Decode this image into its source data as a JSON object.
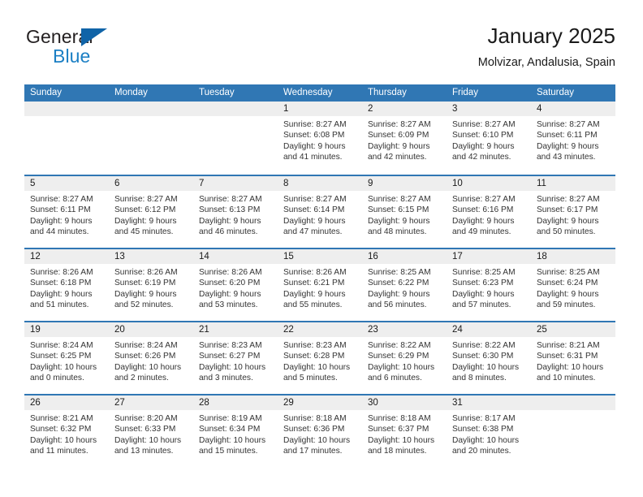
{
  "brand": {
    "name_part1": "General",
    "name_part2": "Blue",
    "flag_icon": "triangle-flag-icon",
    "accent_color": "#1064a8",
    "blue_text_color": "#1b7fc4"
  },
  "header": {
    "title": "January 2025",
    "subtitle": "Molvizar, Andalusia, Spain"
  },
  "theme": {
    "header_blue": "#3077b4",
    "day_band_gray": "#eeeeee",
    "text_color": "#333333"
  },
  "weekdays": [
    "Sunday",
    "Monday",
    "Tuesday",
    "Wednesday",
    "Thursday",
    "Friday",
    "Saturday"
  ],
  "weeks": [
    [
      {
        "day": "",
        "lines": []
      },
      {
        "day": "",
        "lines": []
      },
      {
        "day": "",
        "lines": []
      },
      {
        "day": "1",
        "lines": [
          "Sunrise: 8:27 AM",
          "Sunset: 6:08 PM",
          "Daylight: 9 hours",
          "and 41 minutes."
        ]
      },
      {
        "day": "2",
        "lines": [
          "Sunrise: 8:27 AM",
          "Sunset: 6:09 PM",
          "Daylight: 9 hours",
          "and 42 minutes."
        ]
      },
      {
        "day": "3",
        "lines": [
          "Sunrise: 8:27 AM",
          "Sunset: 6:10 PM",
          "Daylight: 9 hours",
          "and 42 minutes."
        ]
      },
      {
        "day": "4",
        "lines": [
          "Sunrise: 8:27 AM",
          "Sunset: 6:11 PM",
          "Daylight: 9 hours",
          "and 43 minutes."
        ]
      }
    ],
    [
      {
        "day": "5",
        "lines": [
          "Sunrise: 8:27 AM",
          "Sunset: 6:11 PM",
          "Daylight: 9 hours",
          "and 44 minutes."
        ]
      },
      {
        "day": "6",
        "lines": [
          "Sunrise: 8:27 AM",
          "Sunset: 6:12 PM",
          "Daylight: 9 hours",
          "and 45 minutes."
        ]
      },
      {
        "day": "7",
        "lines": [
          "Sunrise: 8:27 AM",
          "Sunset: 6:13 PM",
          "Daylight: 9 hours",
          "and 46 minutes."
        ]
      },
      {
        "day": "8",
        "lines": [
          "Sunrise: 8:27 AM",
          "Sunset: 6:14 PM",
          "Daylight: 9 hours",
          "and 47 minutes."
        ]
      },
      {
        "day": "9",
        "lines": [
          "Sunrise: 8:27 AM",
          "Sunset: 6:15 PM",
          "Daylight: 9 hours",
          "and 48 minutes."
        ]
      },
      {
        "day": "10",
        "lines": [
          "Sunrise: 8:27 AM",
          "Sunset: 6:16 PM",
          "Daylight: 9 hours",
          "and 49 minutes."
        ]
      },
      {
        "day": "11",
        "lines": [
          "Sunrise: 8:27 AM",
          "Sunset: 6:17 PM",
          "Daylight: 9 hours",
          "and 50 minutes."
        ]
      }
    ],
    [
      {
        "day": "12",
        "lines": [
          "Sunrise: 8:26 AM",
          "Sunset: 6:18 PM",
          "Daylight: 9 hours",
          "and 51 minutes."
        ]
      },
      {
        "day": "13",
        "lines": [
          "Sunrise: 8:26 AM",
          "Sunset: 6:19 PM",
          "Daylight: 9 hours",
          "and 52 minutes."
        ]
      },
      {
        "day": "14",
        "lines": [
          "Sunrise: 8:26 AM",
          "Sunset: 6:20 PM",
          "Daylight: 9 hours",
          "and 53 minutes."
        ]
      },
      {
        "day": "15",
        "lines": [
          "Sunrise: 8:26 AM",
          "Sunset: 6:21 PM",
          "Daylight: 9 hours",
          "and 55 minutes."
        ]
      },
      {
        "day": "16",
        "lines": [
          "Sunrise: 8:25 AM",
          "Sunset: 6:22 PM",
          "Daylight: 9 hours",
          "and 56 minutes."
        ]
      },
      {
        "day": "17",
        "lines": [
          "Sunrise: 8:25 AM",
          "Sunset: 6:23 PM",
          "Daylight: 9 hours",
          "and 57 minutes."
        ]
      },
      {
        "day": "18",
        "lines": [
          "Sunrise: 8:25 AM",
          "Sunset: 6:24 PM",
          "Daylight: 9 hours",
          "and 59 minutes."
        ]
      }
    ],
    [
      {
        "day": "19",
        "lines": [
          "Sunrise: 8:24 AM",
          "Sunset: 6:25 PM",
          "Daylight: 10 hours",
          "and 0 minutes."
        ]
      },
      {
        "day": "20",
        "lines": [
          "Sunrise: 8:24 AM",
          "Sunset: 6:26 PM",
          "Daylight: 10 hours",
          "and 2 minutes."
        ]
      },
      {
        "day": "21",
        "lines": [
          "Sunrise: 8:23 AM",
          "Sunset: 6:27 PM",
          "Daylight: 10 hours",
          "and 3 minutes."
        ]
      },
      {
        "day": "22",
        "lines": [
          "Sunrise: 8:23 AM",
          "Sunset: 6:28 PM",
          "Daylight: 10 hours",
          "and 5 minutes."
        ]
      },
      {
        "day": "23",
        "lines": [
          "Sunrise: 8:22 AM",
          "Sunset: 6:29 PM",
          "Daylight: 10 hours",
          "and 6 minutes."
        ]
      },
      {
        "day": "24",
        "lines": [
          "Sunrise: 8:22 AM",
          "Sunset: 6:30 PM",
          "Daylight: 10 hours",
          "and 8 minutes."
        ]
      },
      {
        "day": "25",
        "lines": [
          "Sunrise: 8:21 AM",
          "Sunset: 6:31 PM",
          "Daylight: 10 hours",
          "and 10 minutes."
        ]
      }
    ],
    [
      {
        "day": "26",
        "lines": [
          "Sunrise: 8:21 AM",
          "Sunset: 6:32 PM",
          "Daylight: 10 hours",
          "and 11 minutes."
        ]
      },
      {
        "day": "27",
        "lines": [
          "Sunrise: 8:20 AM",
          "Sunset: 6:33 PM",
          "Daylight: 10 hours",
          "and 13 minutes."
        ]
      },
      {
        "day": "28",
        "lines": [
          "Sunrise: 8:19 AM",
          "Sunset: 6:34 PM",
          "Daylight: 10 hours",
          "and 15 minutes."
        ]
      },
      {
        "day": "29",
        "lines": [
          "Sunrise: 8:18 AM",
          "Sunset: 6:36 PM",
          "Daylight: 10 hours",
          "and 17 minutes."
        ]
      },
      {
        "day": "30",
        "lines": [
          "Sunrise: 8:18 AM",
          "Sunset: 6:37 PM",
          "Daylight: 10 hours",
          "and 18 minutes."
        ]
      },
      {
        "day": "31",
        "lines": [
          "Sunrise: 8:17 AM",
          "Sunset: 6:38 PM",
          "Daylight: 10 hours",
          "and 20 minutes."
        ]
      },
      {
        "day": "",
        "lines": []
      }
    ]
  ]
}
